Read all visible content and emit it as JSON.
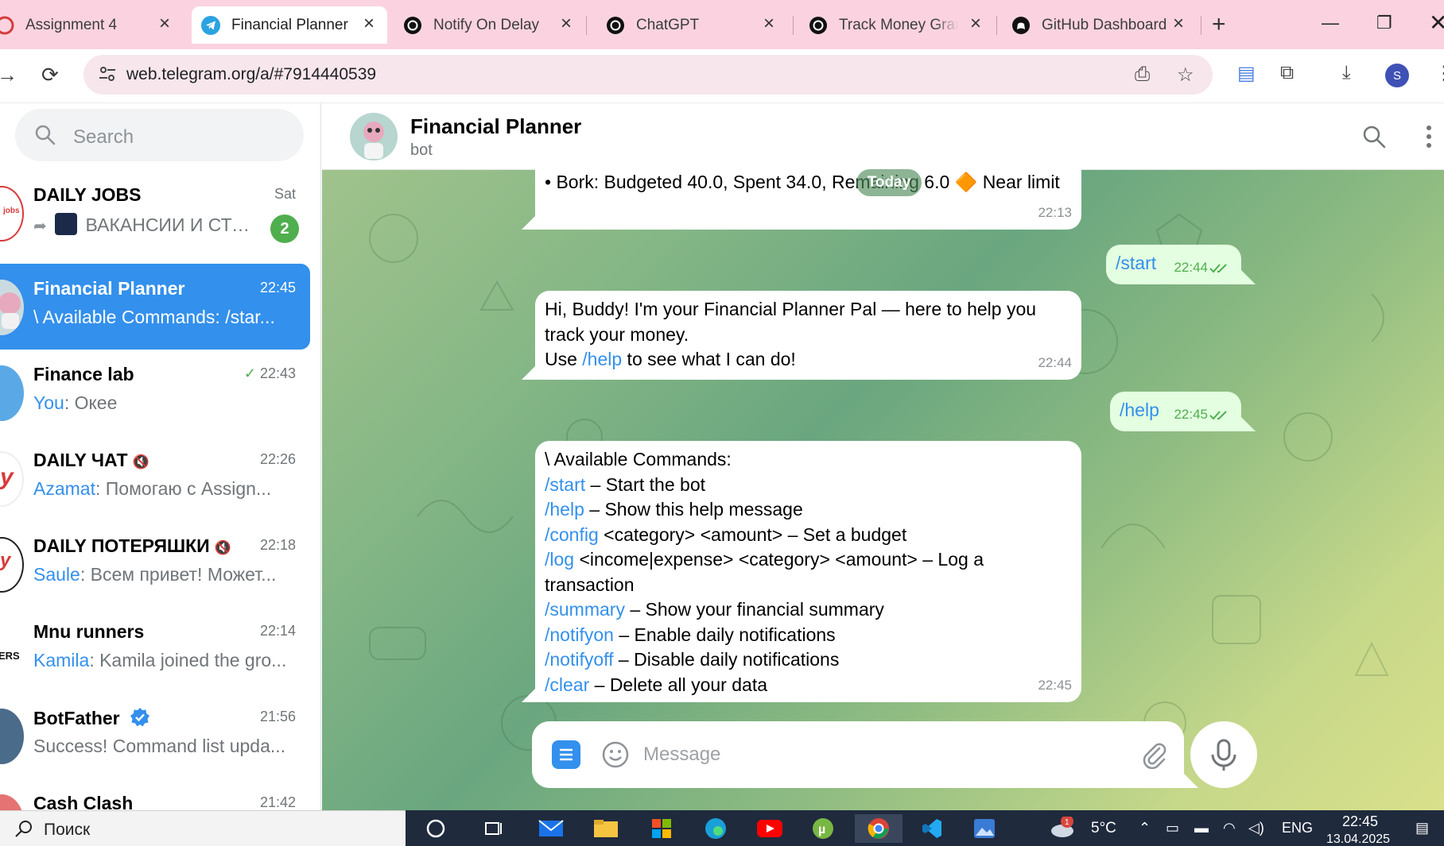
{
  "browser": {
    "tabs": [
      {
        "title": "Assignment 4",
        "icon": "assignment-icon"
      },
      {
        "title": "Financial Planner",
        "icon": "telegram-icon",
        "active": true
      },
      {
        "title": "Notify On Delay",
        "icon": "chatgpt-icon"
      },
      {
        "title": "ChatGPT",
        "icon": "chatgpt-icon"
      },
      {
        "title": "Track Money Gram",
        "icon": "chatgpt-icon"
      },
      {
        "title": "GitHub Dashboard",
        "icon": "github-icon"
      }
    ],
    "url": "web.telegram.org/a/#7914440539",
    "profile_initial": "S"
  },
  "sidebar": {
    "search_placeholder": "Search",
    "chats": [
      {
        "name": "DAILY JOBS",
        "time": "Sat",
        "sender": "",
        "preview": "ВАКАНСИИ И СТА...",
        "unread": "2",
        "forwarded": true
      },
      {
        "name": "Financial Planner",
        "time": "22:45",
        "sender": "",
        "preview": "\\ Available Commands: /star...",
        "active": true
      },
      {
        "name": "Finance lab",
        "time": "22:43",
        "sender": "You",
        "preview": "Окее",
        "read": true
      },
      {
        "name": "DAILY ЧАТ",
        "time": "22:26",
        "sender": "Azamat",
        "preview": "Помогаю с Assign...",
        "muted": true
      },
      {
        "name": "DAILY ПОТЕРЯШКИ",
        "time": "22:18",
        "sender": "Saule",
        "preview": "Всем привет! Может...",
        "muted": true
      },
      {
        "name": "Mnu runners",
        "time": "22:14",
        "sender": "Kamila",
        "preview": "Kamila joined the gro..."
      },
      {
        "name": "BotFather",
        "time": "21:56",
        "sender": "",
        "preview": "Success! Command list upda...",
        "verified": true
      },
      {
        "name": "Cash Clash",
        "time": "21:42",
        "sender": "",
        "preview": ""
      }
    ]
  },
  "chat": {
    "title": "Financial Planner",
    "status": "bot",
    "date_divider": "Today",
    "messages": [
      {
        "dir": "in",
        "text": "• Bork: Budgeted 40.0, Spent 34.0, Remaining 6.0 🔶 Near limit",
        "time": "22:13"
      },
      {
        "dir": "out",
        "text": "/start",
        "time": "22:44"
      },
      {
        "dir": "in",
        "lines": [
          "Hi, Buddy! I'm your Financial Planner Pal — here to help you",
          "track your money."
        ],
        "cmd_line": {
          "before": "Use ",
          "cmd": "/help",
          "after": " to see what I can do!"
        },
        "time": "22:44"
      },
      {
        "dir": "out",
        "text": "/help",
        "time": "22:45"
      },
      {
        "dir": "in",
        "time": "22:45",
        "header": "\\ Available Commands:",
        "commands": [
          {
            "cmd": "/start",
            "desc": " – Start the bot"
          },
          {
            "cmd": "/help",
            "desc": " – Show this help message"
          },
          {
            "cmd": "/config",
            "desc": " <category> <amount> – Set a budget"
          },
          {
            "cmd": "/log",
            "desc": " <income|expense> <category> <amount> – Log a"
          },
          {
            "cmd": "",
            "desc": "transaction"
          },
          {
            "cmd": "/summary",
            "desc": " – Show your financial summary"
          },
          {
            "cmd": "/notifyon",
            "desc": " – Enable daily notifications"
          },
          {
            "cmd": "/notifyoff",
            "desc": " – Disable daily notifications"
          },
          {
            "cmd": "/clear",
            "desc": " – Delete all your data"
          }
        ]
      }
    ],
    "composer_placeholder": "Message"
  },
  "taskbar": {
    "search_text": "Поиск",
    "weather": "5°C",
    "weather_badge": "1",
    "language": "ENG",
    "time": "22:45",
    "date": "13.04.2025"
  },
  "colors": {
    "accent": "#3390ec",
    "tab_strip": "#fbd3e0",
    "unread_badge": "#4fae4e",
    "outgoing_bubble": "#e3fee0"
  }
}
